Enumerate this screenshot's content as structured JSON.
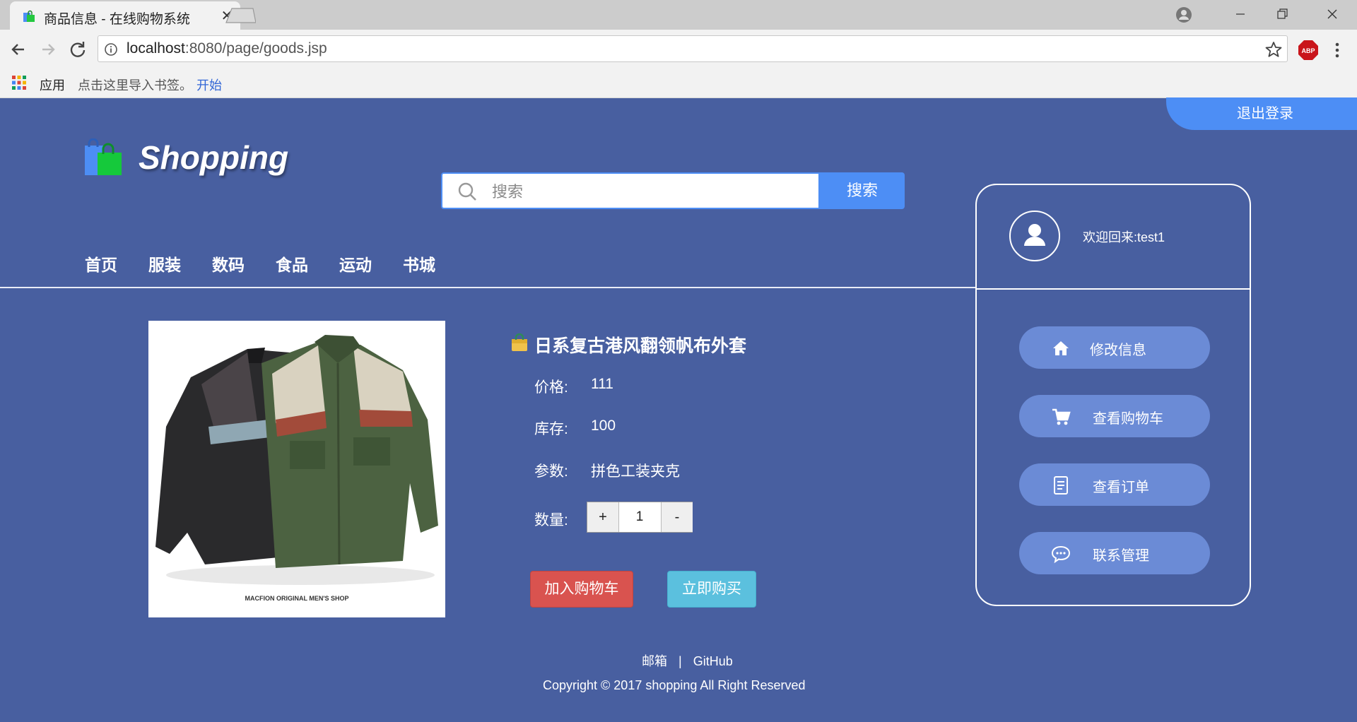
{
  "browser": {
    "tab_title": "商品信息 - 在线购物系统",
    "url_host": "localhost",
    "url_rest": ":8080/page/goods.jsp",
    "bookmarks": {
      "apps": "应用",
      "hint": "点击这里导入书签。",
      "start": "开始"
    },
    "abp_label": "ABP"
  },
  "header": {
    "logout": "退出登录",
    "logo_text": "Shopping",
    "search": {
      "placeholder": "搜索",
      "button": "搜索"
    },
    "nav": [
      "首页",
      "服装",
      "数码",
      "食品",
      "运动",
      "书城"
    ]
  },
  "product": {
    "title": "日系复古港风翻领帆布外套",
    "price_label": "价格:",
    "price": "111",
    "stock_label": "库存:",
    "stock": "100",
    "params_label": "参数:",
    "params": "拼色工装夹克",
    "qty_label": "数量:",
    "qty": "1",
    "plus": "+",
    "minus": "-",
    "add_to_cart": "加入购物车",
    "buy_now": "立即购买",
    "image_caption": "MACFION ORIGINAL MEN'S SHOP"
  },
  "user_panel": {
    "welcome": "欢迎回来:test1",
    "menu": [
      {
        "label": "修改信息",
        "icon": "home-icon"
      },
      {
        "label": "查看购物车",
        "icon": "cart-icon"
      },
      {
        "label": "查看订单",
        "icon": "order-icon"
      },
      {
        "label": "联系管理",
        "icon": "chat-icon"
      }
    ]
  },
  "footer": {
    "email": "邮箱",
    "separator": "|",
    "github": "GitHub",
    "copyright": "Copyright © 2017 shopping All Right Reserved"
  },
  "colors": {
    "page_bg": "#485fa0",
    "accent": "#4d8ef5",
    "menu_btn": "#6b8bd6",
    "danger": "#d9534f",
    "info": "#5bc0de"
  }
}
